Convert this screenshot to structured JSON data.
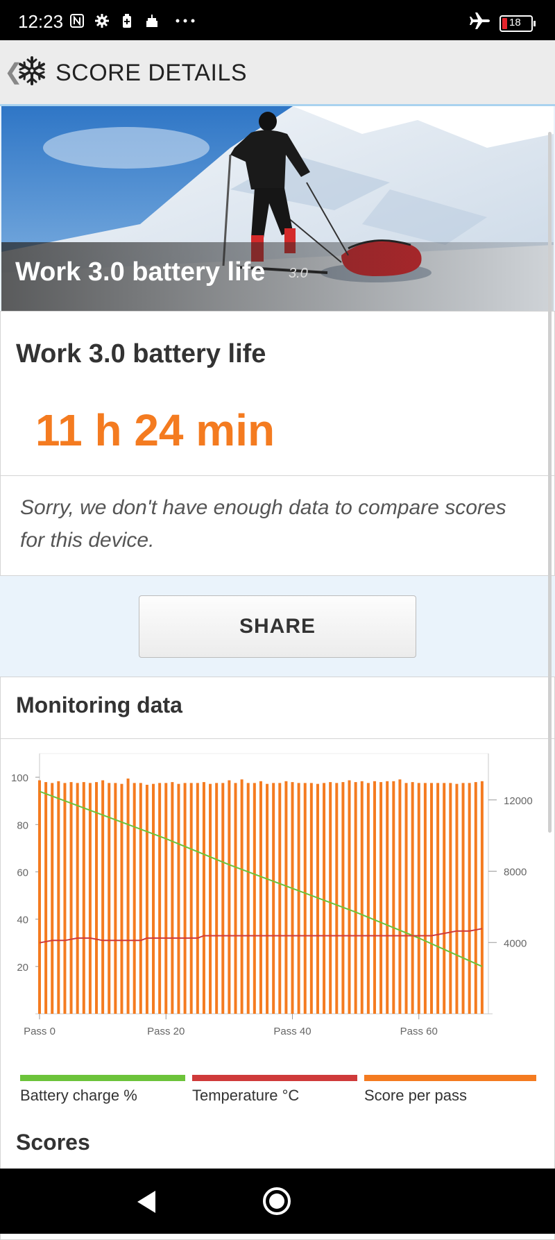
{
  "status_bar": {
    "time": "12:23",
    "battery_level": "18",
    "icons": [
      "nfc-icon",
      "gear-icon",
      "battery-saver-icon",
      "cake-icon",
      "more-dots-icon",
      "airplane-icon",
      "battery-icon"
    ]
  },
  "app_bar": {
    "title": "SCORE DETAILS",
    "icon": "snowflake-icon"
  },
  "hero": {
    "title": "Work 3.0 battery life",
    "version": "3.0"
  },
  "score": {
    "name": "Work 3.0 battery life",
    "value": "11 h 24 min"
  },
  "compare": {
    "message": "Sorry, we don't have enough data to compare scores for this device."
  },
  "share_button": {
    "label": "SHARE"
  },
  "monitoring": {
    "heading": "Monitoring data",
    "legend": [
      {
        "label": "Battery charge %",
        "color": "#6cc33a"
      },
      {
        "label": "Temperature °C",
        "color": "#cf3a3a"
      },
      {
        "label": "Score per pass",
        "color": "#f47b20"
      }
    ]
  },
  "chart_data": {
    "type": "bar",
    "title": "",
    "x_ticks": [
      "Pass 0",
      "Pass 20",
      "Pass 40",
      "Pass 60"
    ],
    "y_left_ticks": [
      "100",
      "80",
      "60",
      "40",
      "20"
    ],
    "y_right_ticks": [
      "12000",
      "8000",
      "4000"
    ],
    "y_left_lim": [
      0,
      110
    ],
    "y_right_lim": [
      0,
      14600
    ],
    "x_lim": [
      0,
      71
    ],
    "grid": false,
    "series": [
      {
        "name": "Score per pass",
        "axis": "right",
        "color": "#f47b20",
        "x": [
          0,
          1,
          2,
          3,
          4,
          5,
          6,
          7,
          8,
          9,
          10,
          11,
          12,
          13,
          14,
          15,
          16,
          17,
          18,
          19,
          20,
          21,
          22,
          23,
          24,
          25,
          26,
          27,
          28,
          29,
          30,
          31,
          32,
          33,
          34,
          35,
          36,
          37,
          38,
          39,
          40,
          41,
          42,
          43,
          44,
          45,
          46,
          47,
          48,
          49,
          50,
          51,
          52,
          53,
          54,
          55,
          56,
          57,
          58,
          59,
          60,
          61,
          62,
          63,
          64,
          65,
          66,
          67,
          68,
          69,
          70
        ],
        "values": [
          13100,
          13000,
          12950,
          13050,
          12950,
          13000,
          12950,
          13000,
          12950,
          13000,
          13100,
          12950,
          12950,
          12900,
          13200,
          12950,
          12950,
          12850,
          12900,
          12950,
          12950,
          13000,
          12900,
          12950,
          12950,
          12950,
          13000,
          12900,
          12950,
          12950,
          13100,
          12950,
          13150,
          12950,
          12950,
          13050,
          12900,
          12950,
          12950,
          13050,
          13000,
          12950,
          12950,
          12950,
          12900,
          12950,
          13000,
          12950,
          13000,
          13100,
          13000,
          13050,
          12950,
          13050,
          13000,
          13050,
          13050,
          13150,
          12950,
          13000,
          12950,
          12950,
          12950,
          12950,
          12950,
          12950,
          12900,
          12950,
          12950,
          13000,
          13050
        ]
      },
      {
        "name": "Battery charge %",
        "axis": "left",
        "color": "#6cc33a",
        "x": [
          0,
          10,
          20,
          30,
          40,
          50,
          60,
          70
        ],
        "values": [
          94,
          84,
          74,
          63,
          53,
          43,
          32,
          20
        ]
      },
      {
        "name": "Temperature °C",
        "axis": "left",
        "color": "#cf3a3a",
        "x": [
          0,
          2,
          4,
          6,
          8,
          10,
          12,
          16,
          17,
          20,
          25,
          26,
          30,
          40,
          50,
          62,
          64,
          66,
          68,
          70
        ],
        "values": [
          30,
          31,
          31,
          32,
          32,
          31,
          31,
          31,
          32,
          32,
          32,
          33,
          33,
          33,
          33,
          33,
          34,
          35,
          35,
          36
        ]
      }
    ]
  },
  "scores_heading": "Scores"
}
